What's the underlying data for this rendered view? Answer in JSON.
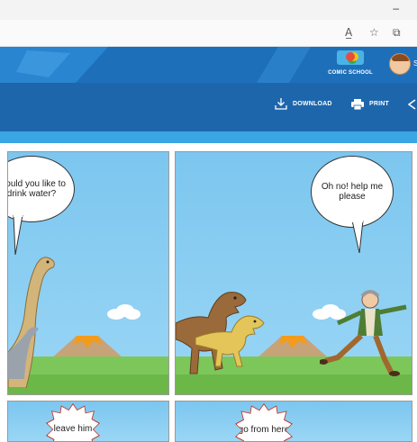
{
  "browser": {
    "minimize_glyph": "–",
    "toolbar_icons": [
      "read-aloud-icon",
      "favorites-icon",
      "collections-icon"
    ]
  },
  "header": {
    "logo_text": "COMIC SCHOOL",
    "avatar_initial": "S"
  },
  "actions": {
    "download_label": "DOWNLOAD",
    "print_label": "PRINT"
  },
  "panels": [
    {
      "bubble": "Would you like to drink water?"
    },
    {
      "bubble": "Oh no! help me please"
    },
    {
      "bubble": "leave him"
    },
    {
      "bubble": "go from here"
    }
  ],
  "colors": {
    "header_blue": "#1e6fb9",
    "action_bar_blue": "#1d66ac",
    "accent_blue": "#3aa6e3",
    "sky": "#7cc6ef",
    "grass": "#7dc75a",
    "burst_outline": "#c0392b"
  }
}
